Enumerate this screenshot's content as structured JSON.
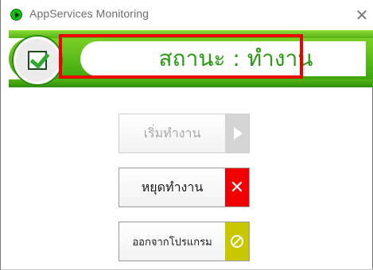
{
  "window": {
    "title": "AppServices Monitoring",
    "close_glyph": "✕"
  },
  "status": {
    "label": "สถานะ : ทำงาน",
    "icon": "checked-box-icon"
  },
  "buttons": {
    "start": {
      "label": "เริ่มทำงาน",
      "icon": "play-icon",
      "enabled": false
    },
    "stop": {
      "label": "หยุดทำงาน",
      "icon": "close-x-icon",
      "glyph": "✕"
    },
    "exit": {
      "label": "ออกจากโปรแกรม",
      "icon": "ban-icon"
    }
  },
  "colors": {
    "accent_green": "#3da70f",
    "status_outline": "#ee0000",
    "stop_red": "#f00000",
    "exit_yellow": "#c9c800",
    "disabled_gray": "#d4d4d4"
  }
}
